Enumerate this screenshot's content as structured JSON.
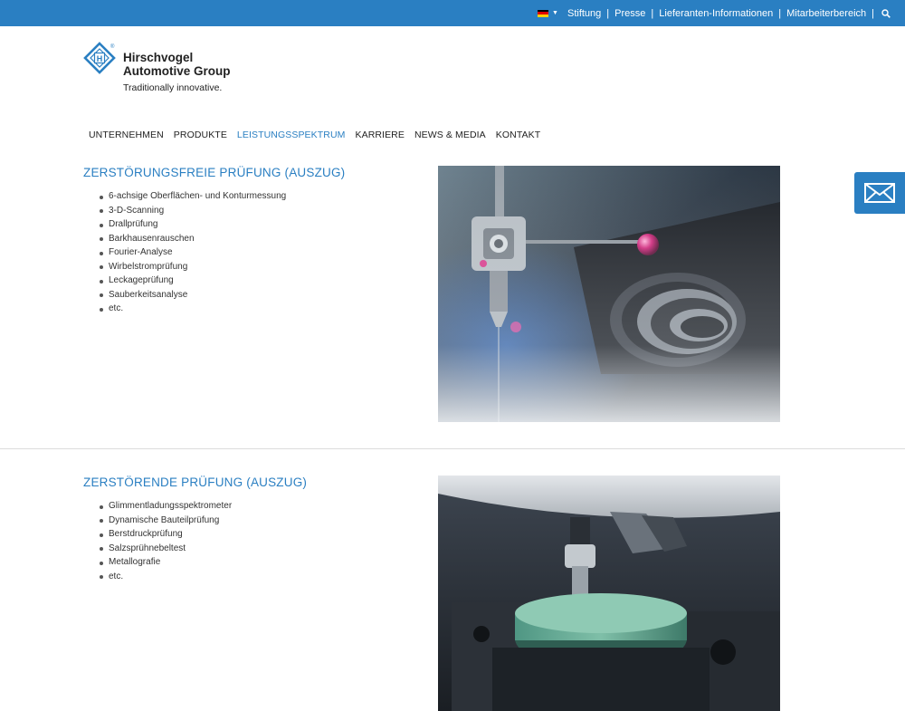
{
  "topbar": {
    "language": "German",
    "links": [
      "Stiftung",
      "Presse",
      "Lieferanten-Informationen",
      "Mitarbeiterbereich"
    ],
    "separator": "|"
  },
  "logo": {
    "line1": "Hirschvogel",
    "line2": "Automotive Group",
    "tagline": "Traditionally innovative.",
    "mark_letter": "H",
    "registered": "®"
  },
  "nav": {
    "items": [
      "UNTERNEHMEN",
      "PRODUKTE",
      "LEISTUNGSSPEKTRUM",
      "KARRIERE",
      "NEWS & MEDIA",
      "KONTAKT"
    ],
    "active_index": 2
  },
  "sections": [
    {
      "title": "ZERSTÖRUNGSFREIE PRÜFUNG (AUSZUG)",
      "items": [
        "6-achsige Oberflächen- und Konturmessung",
        "3-D-Scanning",
        "Drallprüfung",
        "Barkhausenrauschen",
        "Fourier-Analyse",
        "Wirbelstromprüfung",
        "Leckageprüfung",
        "Sauberkeitsanalyse",
        "etc."
      ]
    },
    {
      "title": "ZERSTÖRENDE PRÜFUNG (AUSZUG)",
      "items": [
        "Glimmentladungsspektrometer",
        "Dynamische Bauteilprüfung",
        "Berstdruckprüfung",
        "Salzsprühnebeltest",
        "Metallografie",
        "etc."
      ]
    }
  ],
  "colors": {
    "brand_blue": "#2a7fc2",
    "text": "#333333"
  }
}
